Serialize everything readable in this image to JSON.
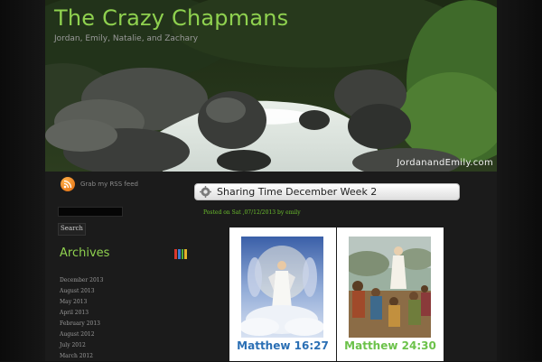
{
  "header": {
    "site_title": "The Crazy Chapmans",
    "tagline": "Jordan, Emily, Natalie, and Zachary",
    "watermark": "JordanandEmily.com"
  },
  "sidebar": {
    "rss_label": "Grab my RSS feed",
    "search_button": "Search",
    "search_value": "",
    "archives_title": "Archives",
    "archives": [
      "December 2013",
      "August 2013",
      "May 2013",
      "April 2013",
      "February 2013",
      "August 2012",
      "July 2012",
      "March 2012"
    ]
  },
  "post": {
    "title": "Sharing Time December Week 2",
    "meta_prefix": "Posted on Sat ,07/12/2013 by",
    "author": "emily",
    "panels": [
      {
        "caption": "Matthew 16:27",
        "caption_color": "#2b6fb4"
      },
      {
        "caption": "Matthew 24:30",
        "caption_color": "#6cc24a"
      }
    ]
  },
  "colors": {
    "accent_green": "#8fd14f",
    "meta_green": "#6cbf2e",
    "background": "#1b1b1b"
  }
}
